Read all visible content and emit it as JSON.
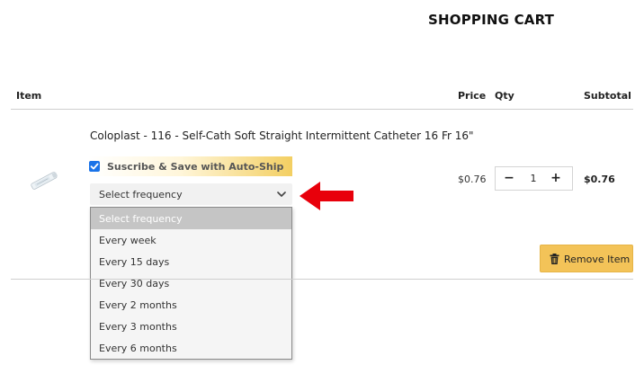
{
  "page": {
    "title": "SHOPPING CART"
  },
  "table": {
    "headers": {
      "item": "Item",
      "price": "Price",
      "qty": "Qty",
      "subtotal": "Subtotal"
    }
  },
  "product": {
    "name": "Coloplast - 116 - Self-Cath Soft Straight Intermittent Catheter 16 Fr 16\"",
    "thumbnail_icon": "catheter-product-image",
    "price": "$0.76",
    "quantity": "1",
    "subtotal": "$0.76"
  },
  "autoship": {
    "label": "Suscribe & Save with Auto-Ship",
    "checked": true,
    "select_value": "Select frequency",
    "options": [
      "Select frequency",
      "Every week",
      "Every 15 days",
      "Every 30 days",
      "Every 2 months",
      "Every 3 months",
      "Every 6 months"
    ]
  },
  "quantity_control": {
    "minus_symbol": "−",
    "plus_symbol": "+"
  },
  "actions": {
    "remove_label": "Remove Item",
    "remove_icon": "trash-icon"
  },
  "colors": {
    "accent": "#f3c358",
    "checkbox": "#1a73e8",
    "arrow": "#e8000b",
    "selected_option": "#c5c5c5"
  }
}
